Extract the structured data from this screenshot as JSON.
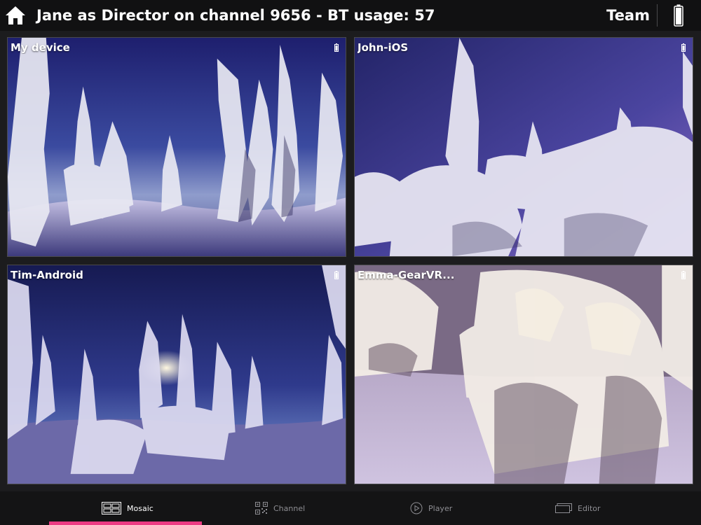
{
  "header": {
    "title": "Jane as Director on channel 9656 - BT usage: 57",
    "team_label": "Team",
    "home_icon": "home-icon",
    "battery_icon": "battery-icon"
  },
  "tiles": [
    {
      "label": "My device"
    },
    {
      "label": "John-iOS"
    },
    {
      "label": "Tim-Android"
    },
    {
      "label": "Emma-GearVR..."
    }
  ],
  "tabs": [
    {
      "label": "Mosaic",
      "icon": "mosaic-icon",
      "active": true
    },
    {
      "label": "Channel",
      "icon": "qr-code-icon",
      "active": false
    },
    {
      "label": "Player",
      "icon": "play-icon",
      "active": false
    },
    {
      "label": "Editor",
      "icon": "editor-icon",
      "active": false
    }
  ],
  "colors": {
    "accent": "#ec3b83",
    "background": "#1c1c1e",
    "header": "#111112"
  }
}
